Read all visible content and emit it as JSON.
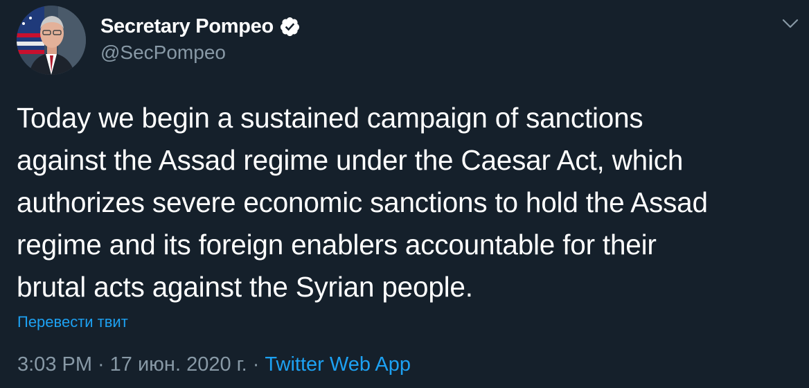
{
  "tweet": {
    "display_name": "Secretary Pompeo",
    "handle": "@SecPompeo",
    "verified": true,
    "text_lines": [
      "Today we begin a sustained campaign of sanctions",
      "against the Assad regime under the Caesar Act, which",
      "authorizes severe economic sanctions to hold the Assad",
      "regime and its foreign enablers accountable for their",
      "brutal acts against the Syrian people."
    ],
    "translate_label": "Перевести твит",
    "time": "3:03 PM",
    "date": "17 июн. 2020 г.",
    "separator": "·",
    "source": "Twitter Web App"
  },
  "icons": {
    "avatar": "avatar",
    "verified": "verified-badge-icon",
    "more": "chevron-down-icon"
  },
  "colors": {
    "background": "#15202b",
    "text": "#ffffff",
    "secondary": "#8899a6",
    "link": "#1da1f2"
  }
}
